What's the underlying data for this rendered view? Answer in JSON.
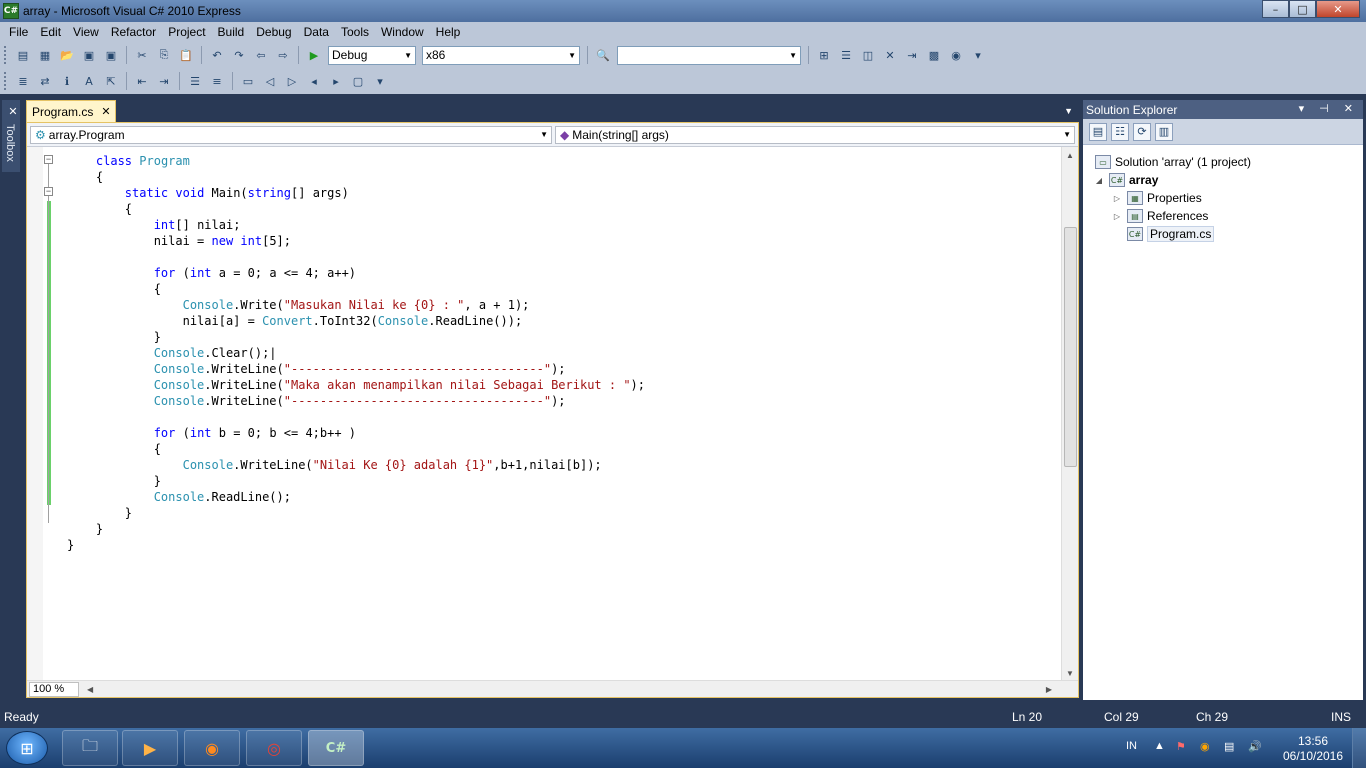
{
  "window": {
    "title": "array - Microsoft Visual C# 2010 Express",
    "app_icon": "C#",
    "minimize": "–",
    "maximize": "□",
    "close": "✕"
  },
  "menu": [
    "File",
    "Edit",
    "View",
    "Refactor",
    "Project",
    "Build",
    "Debug",
    "Data",
    "Tools",
    "Window",
    "Help"
  ],
  "toolbar": {
    "config_value": "Debug",
    "platform_value": "x86",
    "find_value": ""
  },
  "toolbox": {
    "label": "Toolbox"
  },
  "document": {
    "tab_label": "Program.cs",
    "tab_close": "✕",
    "type_nav": "array.Program",
    "member_nav": "Main(string[] args)",
    "zoom": "100 %",
    "code_lines": [
      [
        {
          "t": "    "
        },
        {
          "t": "class",
          "c": "kw"
        },
        {
          "t": " "
        },
        {
          "t": "Program",
          "c": "ty"
        }
      ],
      [
        {
          "t": "    {"
        }
      ],
      [
        {
          "t": "        "
        },
        {
          "t": "static",
          "c": "kw"
        },
        {
          "t": " "
        },
        {
          "t": "void",
          "c": "kw"
        },
        {
          "t": " Main("
        },
        {
          "t": "string",
          "c": "kw"
        },
        {
          "t": "[] args)"
        }
      ],
      [
        {
          "t": "        {"
        }
      ],
      [
        {
          "t": "            "
        },
        {
          "t": "int",
          "c": "kw"
        },
        {
          "t": "[] nilai;"
        }
      ],
      [
        {
          "t": "            nilai = "
        },
        {
          "t": "new",
          "c": "kw"
        },
        {
          "t": " "
        },
        {
          "t": "int",
          "c": "kw"
        },
        {
          "t": "[5];"
        }
      ],
      [
        {
          "t": ""
        }
      ],
      [
        {
          "t": "            "
        },
        {
          "t": "for",
          "c": "kw"
        },
        {
          "t": " ("
        },
        {
          "t": "int",
          "c": "kw"
        },
        {
          "t": " a = 0; a <= 4; a++)"
        }
      ],
      [
        {
          "t": "            {"
        }
      ],
      [
        {
          "t": "                "
        },
        {
          "t": "Console",
          "c": "ty"
        },
        {
          "t": ".Write("
        },
        {
          "t": "\"Masukan Nilai ke {0} : \"",
          "c": "st"
        },
        {
          "t": ", a + 1);"
        }
      ],
      [
        {
          "t": "                nilai[a] = "
        },
        {
          "t": "Convert",
          "c": "ty"
        },
        {
          "t": ".ToInt32("
        },
        {
          "t": "Console",
          "c": "ty"
        },
        {
          "t": ".ReadLine());"
        }
      ],
      [
        {
          "t": "            }"
        }
      ],
      [
        {
          "t": "            "
        },
        {
          "t": "Console",
          "c": "ty"
        },
        {
          "t": ".Clear();|"
        }
      ],
      [
        {
          "t": "            "
        },
        {
          "t": "Console",
          "c": "ty"
        },
        {
          "t": ".WriteLine("
        },
        {
          "t": "\"-----------------------------------\"",
          "c": "st"
        },
        {
          "t": ");"
        }
      ],
      [
        {
          "t": "            "
        },
        {
          "t": "Console",
          "c": "ty"
        },
        {
          "t": ".WriteLine("
        },
        {
          "t": "\"Maka akan menampilkan nilai Sebagai Berikut : \"",
          "c": "st"
        },
        {
          "t": ");"
        }
      ],
      [
        {
          "t": "            "
        },
        {
          "t": "Console",
          "c": "ty"
        },
        {
          "t": ".WriteLine("
        },
        {
          "t": "\"-----------------------------------\"",
          "c": "st"
        },
        {
          "t": ");"
        }
      ],
      [
        {
          "t": ""
        }
      ],
      [
        {
          "t": "            "
        },
        {
          "t": "for",
          "c": "kw"
        },
        {
          "t": " ("
        },
        {
          "t": "int",
          "c": "kw"
        },
        {
          "t": " b = 0; b <= 4;b++ )"
        }
      ],
      [
        {
          "t": "            {"
        }
      ],
      [
        {
          "t": "                "
        },
        {
          "t": "Console",
          "c": "ty"
        },
        {
          "t": ".WriteLine("
        },
        {
          "t": "\"Nilai Ke {0} adalah {1}\"",
          "c": "st"
        },
        {
          "t": ",b+1,nilai[b]);"
        }
      ],
      [
        {
          "t": "            }"
        }
      ],
      [
        {
          "t": "            "
        },
        {
          "t": "Console",
          "c": "ty"
        },
        {
          "t": ".ReadLine();"
        }
      ],
      [
        {
          "t": "        }"
        }
      ],
      [
        {
          "t": "    }"
        }
      ],
      [
        {
          "t": "}"
        }
      ]
    ]
  },
  "solution_explorer": {
    "title": "Solution Explorer",
    "head_buttons": "▾ ⊣ ✕",
    "solution": "Solution 'array' (1 project)",
    "project": "array",
    "items": [
      "Properties",
      "References",
      "Program.cs"
    ]
  },
  "status": {
    "text": "Ready",
    "ln": "Ln 20",
    "col": "Col 29",
    "ch": "Ch 29",
    "mode": "INS"
  },
  "taskbar": {
    "lang": "IN",
    "time": "13:56",
    "date": "06/10/2016",
    "apps": [
      "file-explorer",
      "media-player",
      "firefox",
      "chrome",
      "visual-csharp"
    ]
  }
}
